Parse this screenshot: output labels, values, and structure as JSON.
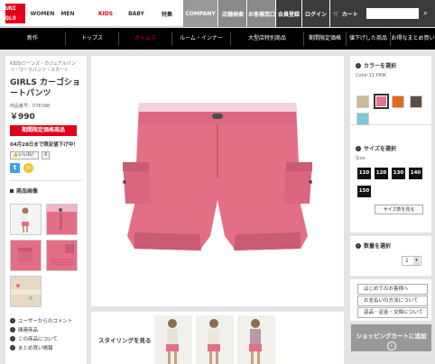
{
  "header": {
    "logo": {
      "q1": "UNI",
      "q2": "",
      "q3": "QLO",
      "q4": ""
    },
    "nav": [
      "WOMEN",
      "MEN",
      "KIDS",
      "BABY",
      "特集",
      "COMPANY"
    ],
    "utility": [
      "店舗検索",
      "お客様窓口",
      "会員登録",
      "ログイン",
      "カート"
    ],
    "search_placeholder": ""
  },
  "subnav": [
    "新作",
    "トップス",
    "ボトムス",
    "ルーム・インナー",
    "大型店特別商品",
    "期間限定価格",
    "値下げした商品",
    "お得なまとめ買い"
  ],
  "product": {
    "breadcrumb": "KIDS/ジーンズ・カジュアルパンツ・ワークパンツ・スカート",
    "name": "GIRLS カーゴショートパンツ",
    "number_label": "商品番号",
    "number": "076398",
    "price": "￥990",
    "sale_badge": "期間限定価格商品",
    "limit_note": "04月28日まで限定値下げ中！",
    "like_label": "いいね！",
    "like_count": "0",
    "images_heading": "商品画像",
    "links": [
      "ユーザーからのコメント",
      "関連商品",
      "この商品について",
      "まとめ買い情報"
    ]
  },
  "styling": {
    "label": "スタイリングを見る"
  },
  "options": {
    "color_heading": "カラーを選択",
    "color_value": "Color:11 PINK",
    "swatch_colors": [
      "#cdb99a",
      "#e57492",
      "#e06a1f",
      "#5a4e46",
      "#7ec5d8"
    ],
    "size_heading": "サイズを選択",
    "size_label": "Size:",
    "sizes": [
      "110",
      "120",
      "130",
      "140",
      "150"
    ],
    "size_guide": "サイズ表を見る",
    "qty_heading": "数量を選択",
    "qty_value": "1"
  },
  "info_links": [
    "はじめてのお客様へ",
    "お支払いの方法について",
    "返品・返金・交換について"
  ],
  "cart_button": "ショッピングカートに追加",
  "colors": {
    "brand": "#e0001a",
    "shorts": "#e36f86"
  }
}
